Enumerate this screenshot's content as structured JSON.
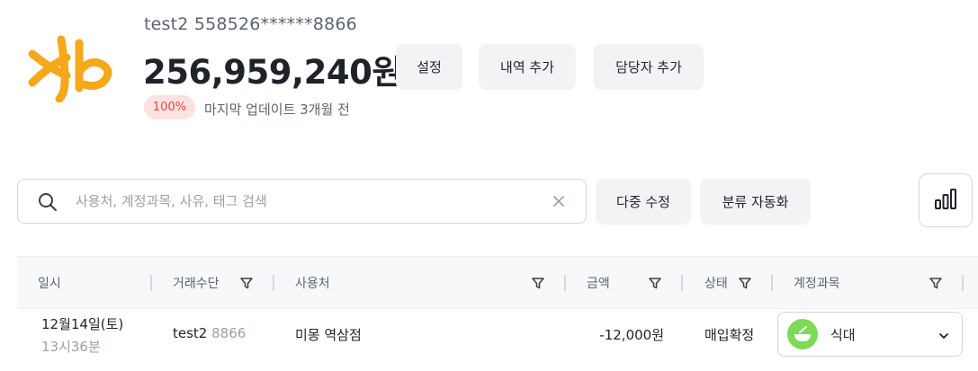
{
  "account": {
    "label": "test2 558526******8866",
    "balance": "256,959,240원",
    "sync_badge": "100%",
    "last_update": "마지막 업데이트 3개월 전",
    "logo_icon": "kb-logo"
  },
  "header_buttons": {
    "settings": "설정",
    "add_history": "내역 추가",
    "add_manager": "담당자 추가"
  },
  "toolbar": {
    "search_placeholder": "사용처, 계정과목, 사유, 태그 검색",
    "search_value": "",
    "bulk_edit": "다중 수정",
    "auto_classify": "분류 자동화",
    "chart_icon": "bar-chart-icon"
  },
  "table": {
    "columns": {
      "date": "일시",
      "method": "거래수단",
      "merchant": "사용처",
      "amount": "금액",
      "status": "상태",
      "account": "계정과목"
    },
    "rows": [
      {
        "date": "12월14일(토)",
        "time": "13시36분",
        "method_name": "test2",
        "method_suffix": "8866",
        "merchant": "미몽 역삼점",
        "amount": "-12,000원",
        "status": "매입확정",
        "category": "식대",
        "category_icon": "food-bowl-icon"
      }
    ]
  },
  "colors": {
    "brand_yellow": "#F5A81C",
    "badge_bg": "#FDE2E2",
    "badge_text": "#E8463F",
    "category_icon_green": "#7ED957",
    "button_bg": "#F2F3F5"
  }
}
